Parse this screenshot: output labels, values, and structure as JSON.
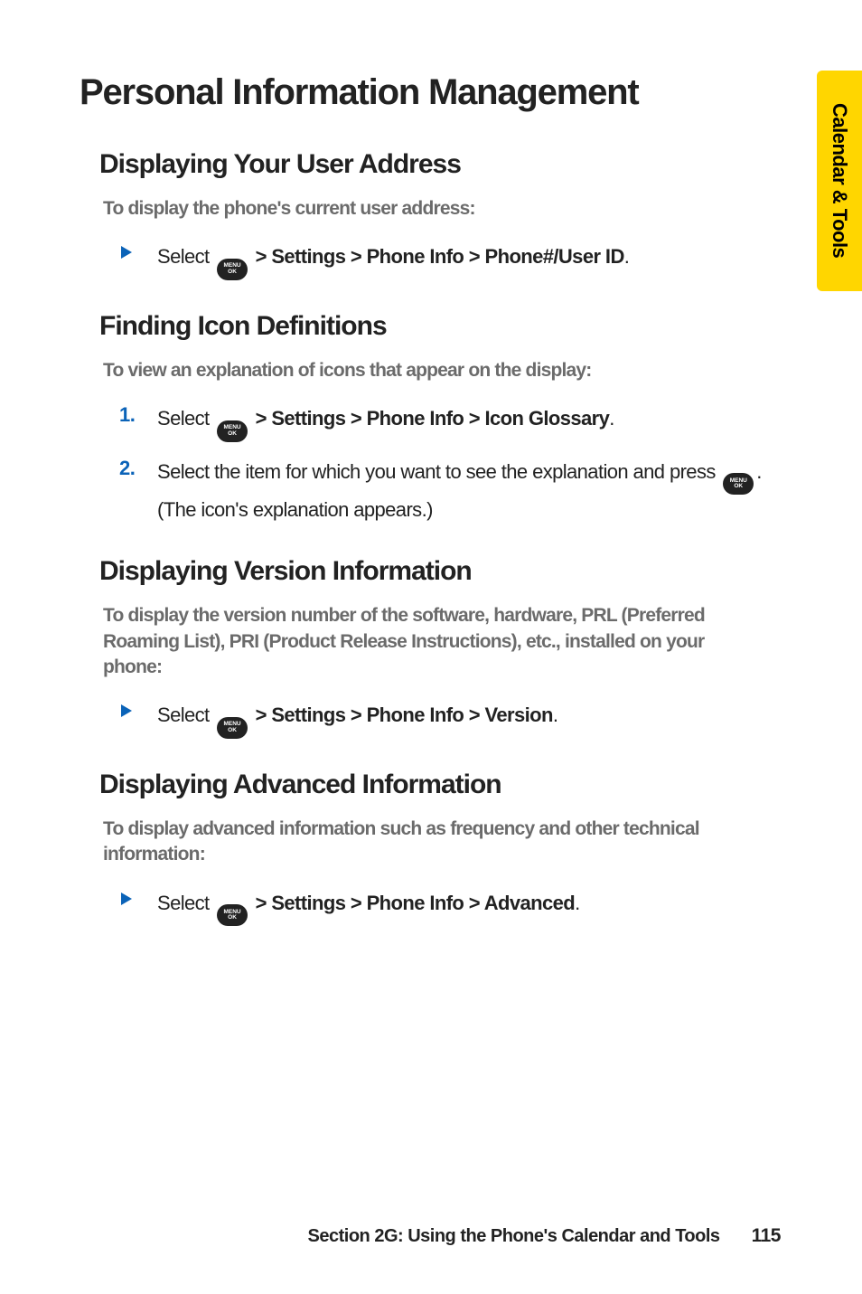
{
  "sideTab": "Calendar & Tools",
  "pageTitle": "Personal Information Management",
  "keyLabel": "MENU\nOK",
  "sections": [
    {
      "title": "Displaying Your User Address",
      "sub": "To display the phone's current user address:",
      "items": [
        {
          "type": "bullet",
          "lead": "Select ",
          "pathPrefix": " > ",
          "path": "Settings > Phone Info > Phone#/User ID",
          "trail": "."
        }
      ]
    },
    {
      "title": "Finding Icon Definitions",
      "sub": "To view an explanation of icons that appear on the display:",
      "items": [
        {
          "type": "num",
          "num": "1.",
          "lead": "Select ",
          "pathPrefix": " > ",
          "path": "Settings > Phone Info > Icon Glossary",
          "trail": "."
        },
        {
          "type": "num",
          "num": "2.",
          "textBefore": "Select the item for which you want to see the explanation and press ",
          "textAfter": ". (The icon's explanation appears.)"
        }
      ]
    },
    {
      "title": "Displaying Version Information",
      "sub": "To display the version number of the software, hardware, PRL (Preferred Roaming List), PRI (Product Release Instructions), etc., installed on your phone:",
      "items": [
        {
          "type": "bullet",
          "lead": "Select ",
          "pathPrefix": " > ",
          "path": "Settings > Phone Info > Version",
          "trail": "."
        }
      ]
    },
    {
      "title": "Displaying Advanced Information",
      "sub": "To display advanced information such as frequency and other technical information:",
      "items": [
        {
          "type": "bullet",
          "lead": "Select ",
          "pathPrefix": " > ",
          "path": "Settings > Phone Info > Advanced",
          "trail": "."
        }
      ]
    }
  ],
  "footer": {
    "section": "Section 2G: Using the Phone's Calendar and Tools",
    "page": "115"
  }
}
